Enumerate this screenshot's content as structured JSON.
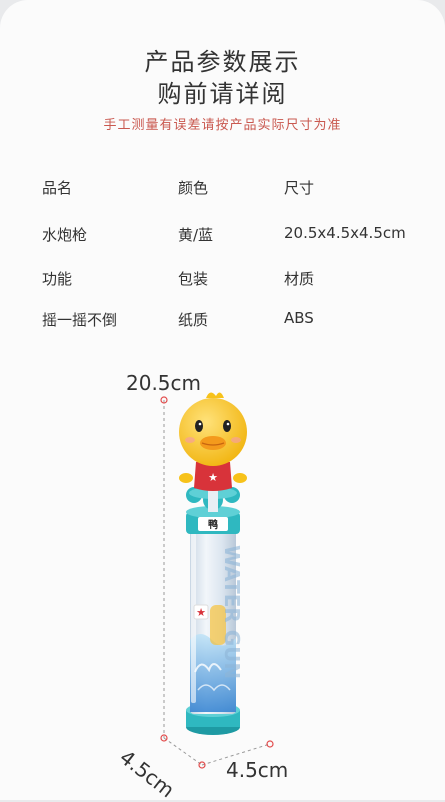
{
  "header": {
    "title_line1": "产品参数展示",
    "title_line2": "购前请详阅",
    "note": "手工测量有误差请按产品实际尺寸为准"
  },
  "specs": {
    "row1": [
      "品名",
      "颜色",
      "尺寸"
    ],
    "row2": [
      "水炮枪",
      "黄/蓝",
      "20.5x4.5x4.5cm"
    ],
    "row3": [
      "功能",
      "包装",
      "材质"
    ],
    "row4": [
      "摇一摇不倒",
      "纸质",
      "ABS"
    ]
  },
  "dimensions": {
    "height": "20.5cm",
    "depth": "4.5cm",
    "width": "4.5cm"
  },
  "product": {
    "vertical_text": "WATER GUN",
    "colors": {
      "duck": "#f7c21a",
      "shirt": "#d8333a",
      "cap": "#2fb8c0",
      "tube": "#dfe9f2",
      "water": "#3a8fd6"
    }
  }
}
